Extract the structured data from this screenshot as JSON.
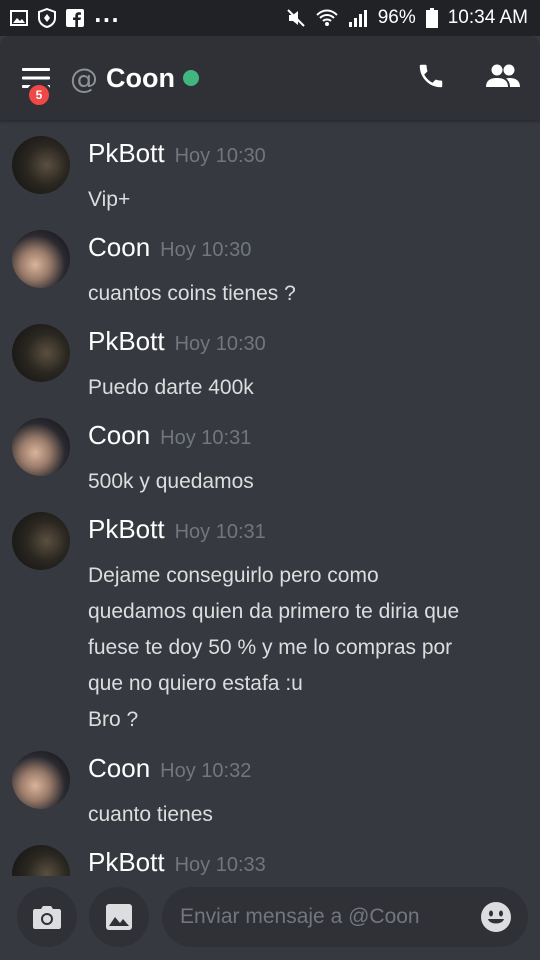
{
  "status_bar": {
    "dots": "...",
    "battery": "96%",
    "time": "10:34 AM"
  },
  "header": {
    "notification_count": "5",
    "at_symbol": "@",
    "title": "Coon",
    "online_color": "#43b581"
  },
  "messages": [
    {
      "author": "PkBott",
      "time": "Hoy 10:30",
      "avatar": "pkbott",
      "lines": [
        "Vip+"
      ]
    },
    {
      "author": "Coon",
      "time": "Hoy 10:30",
      "avatar": "coon",
      "lines": [
        "cuantos coins tienes ?"
      ]
    },
    {
      "author": "PkBott",
      "time": "Hoy 10:30",
      "avatar": "pkbott",
      "lines": [
        "Puedo darte 400k"
      ]
    },
    {
      "author": "Coon",
      "time": "Hoy 10:31",
      "avatar": "coon",
      "lines": [
        "500k y quedamos"
      ]
    },
    {
      "author": "PkBott",
      "time": "Hoy 10:31",
      "avatar": "pkbott",
      "lines": [
        "Dejame conseguirlo pero como",
        "quedamos quien da primero te diria que",
        "fuese te doy 50 % y me lo compras por",
        "que no quiero estafa :u",
        "Bro ?"
      ]
    },
    {
      "author": "Coon",
      "time": "Hoy 10:32",
      "avatar": "coon",
      "lines": [
        "cuanto tienes"
      ]
    },
    {
      "author": "PkBott",
      "time": "Hoy 10:33",
      "avatar": "pkbott",
      "lines": []
    }
  ],
  "composer": {
    "placeholder": "Enviar mensaje a @Coon"
  },
  "colors": {
    "background": "#36393f",
    "header": "#2f3136",
    "badge": "#f04747"
  }
}
